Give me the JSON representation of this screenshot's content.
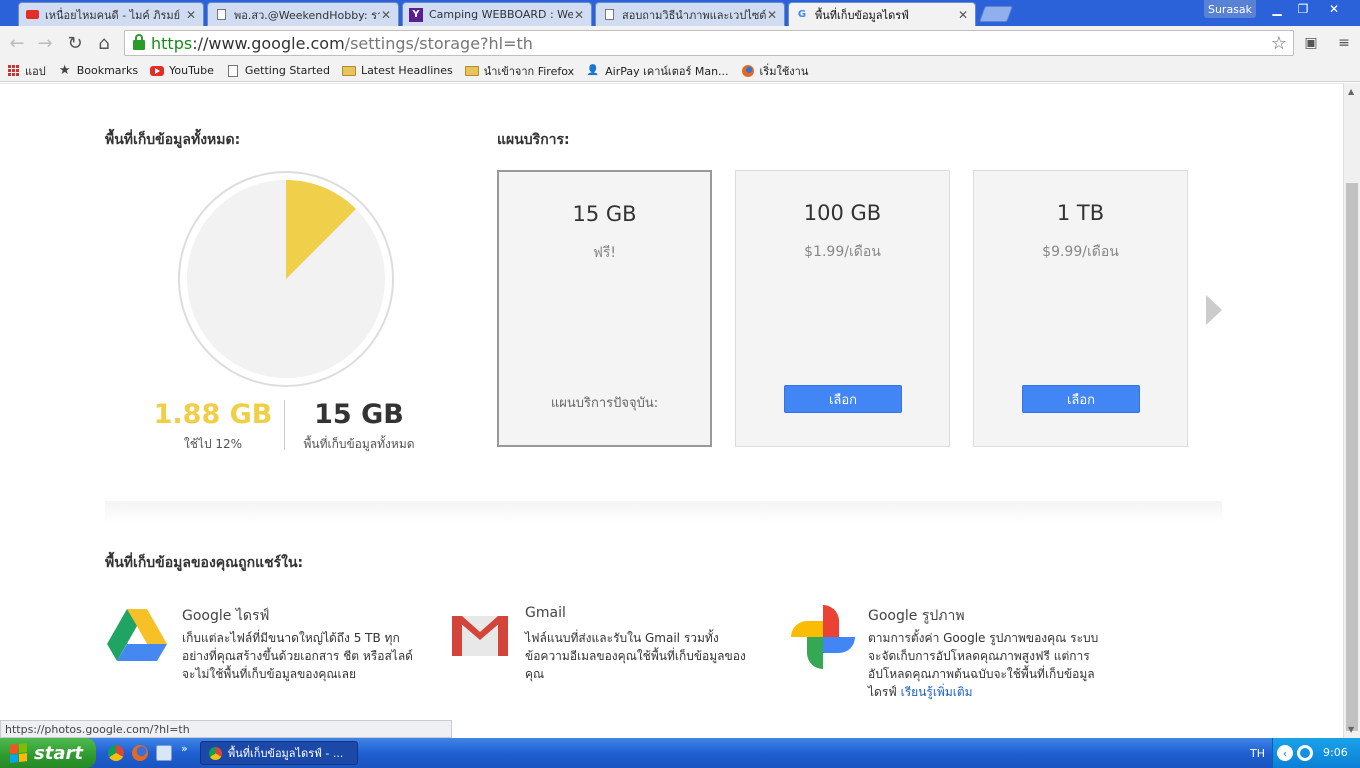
{
  "browser": {
    "tabs": [
      {
        "label": "เหนื่อยไหมคนดี - ไมค์ ภิรมย์",
        "icon": "youtube-icon",
        "active": false
      },
      {
        "label": "พอ.สว.@WeekendHobby: ราย",
        "icon": "page-icon",
        "active": false
      },
      {
        "label": "Camping WEBBOARD : Week",
        "icon": "yahoo-icon",
        "active": false
      },
      {
        "label": "สอบถามวิธีนำภาพและเวปไซต์",
        "icon": "page-icon",
        "active": false
      },
      {
        "label": "พื้นที่เก็บข้อมูลไดรฟ์",
        "icon": "google-icon",
        "active": true
      }
    ],
    "user": "Surasak",
    "url_scheme": "https",
    "url_host": "://www.google.com",
    "url_rest": "/settings/storage?hl=th",
    "bookmarks": [
      {
        "label": "แอป",
        "icon": "apps-icon"
      },
      {
        "label": "Bookmarks",
        "icon": "star-icon"
      },
      {
        "label": "YouTube",
        "icon": "youtube-icon"
      },
      {
        "label": "Getting Started",
        "icon": "page-icon"
      },
      {
        "label": "Latest Headlines",
        "icon": "folder-icon"
      },
      {
        "label": "นำเข้าจาก Firefox",
        "icon": "folder-icon"
      },
      {
        "label": "AirPay เคาน์เตอร์ Man...",
        "icon": "airpay-icon"
      },
      {
        "label": "เริ่มใช้งาน",
        "icon": "firefox-icon"
      }
    ]
  },
  "storage": {
    "title": "พื้นที่เก็บข้อมูลทั้งหมด:",
    "used_value": "1.88 GB",
    "used_label": "ใช้ไป 12%",
    "used_fraction": 0.125,
    "total_value": "15 GB",
    "total_label": "พื้นที่เก็บข้อมูลทั้งหมด",
    "used_color": "#f0d04a"
  },
  "plans": {
    "title": "แผนบริการ:",
    "items": [
      {
        "size": "15 GB",
        "price": "ฟรี!",
        "current_label": "แผนบริการปัจจุบัน:",
        "current": true
      },
      {
        "size": "100 GB",
        "price": "$1.99/เดือน",
        "button": "เลือก",
        "current": false
      },
      {
        "size": "1 TB",
        "price": "$9.99/เดือน",
        "button": "เลือก",
        "current": false
      }
    ]
  },
  "shared": {
    "title": "พื้นที่เก็บข้อมูลของคุณถูกแชร์ใน:",
    "services": [
      {
        "name": "Google ไดรฟ์",
        "icon": "google-drive-icon",
        "desc": "เก็บแต่ละไฟล์ที่มีขนาดใหญ่ได้ถึง 5 TB ทุกอย่างที่คุณสร้างขึ้นด้วยเอกสาร ชีต หรือสไลด์จะไม่ใช้พื้นที่เก็บข้อมูลของคุณเลย"
      },
      {
        "name": "Gmail",
        "icon": "gmail-icon",
        "desc": "ไฟล์แนบที่ส่งและรับใน Gmail รวมทั้งข้อความอีเมลของคุณใช้พื้นที่เก็บข้อมูลของคุณ"
      },
      {
        "name": "Google รูปภาพ",
        "icon": "google-photos-icon",
        "desc": "ตามการตั้งค่า Google รูปภาพของคุณ ระบบจะจัดเก็บการอัปโหลดคุณภาพสูงฟรี แต่การอัปโหลดคุณภาพต้นฉบับจะใช้พื้นที่เก็บข้อมูลไดรฟ์",
        "link": "เรียนรู้เพิ่มเติม"
      }
    ]
  },
  "statusbar": "https://photos.google.com/?hl=th",
  "taskbar": {
    "start": "start",
    "window": "พื้นที่เก็บข้อมูลไดรฟ์ - ...",
    "lang": "TH",
    "clock": "9:06"
  }
}
